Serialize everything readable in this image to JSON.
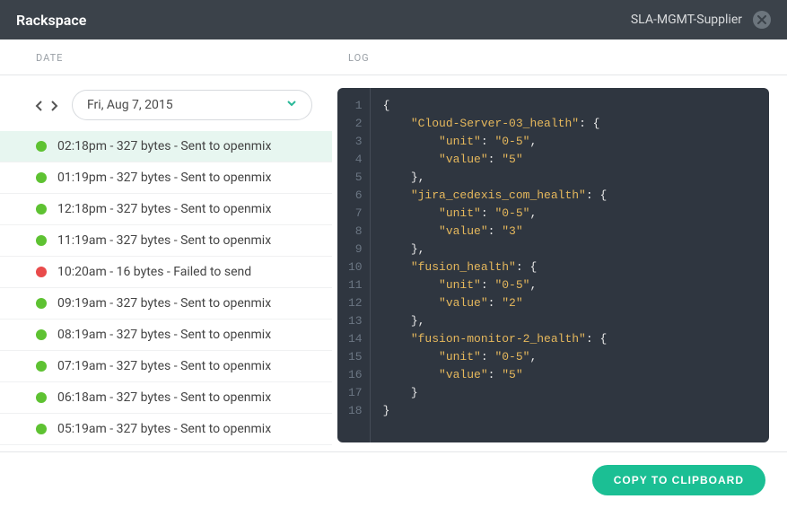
{
  "header": {
    "title": "Rackspace",
    "subtitle": "SLA-MGMT-Supplier"
  },
  "columns": {
    "date_label": "DATE",
    "log_label": "LOG"
  },
  "date_picker": {
    "value": "Fri, Aug 7, 2015"
  },
  "logs": [
    {
      "status": "ok",
      "time": "02:18pm",
      "bytes": "327 bytes",
      "msg": "Sent to openmix",
      "selected": true
    },
    {
      "status": "ok",
      "time": "01:19pm",
      "bytes": "327 bytes",
      "msg": "Sent to openmix",
      "selected": false
    },
    {
      "status": "ok",
      "time": "12:18pm",
      "bytes": "327 bytes",
      "msg": "Sent to openmix",
      "selected": false
    },
    {
      "status": "ok",
      "time": "11:19am",
      "bytes": "327 bytes",
      "msg": "Sent to openmix",
      "selected": false
    },
    {
      "status": "err",
      "time": "10:20am",
      "bytes": "16 bytes",
      "msg": "Failed to send",
      "selected": false
    },
    {
      "status": "ok",
      "time": "09:19am",
      "bytes": "327 bytes",
      "msg": "Sent to openmix",
      "selected": false
    },
    {
      "status": "ok",
      "time": "08:19am",
      "bytes": "327 bytes",
      "msg": "Sent to openmix",
      "selected": false
    },
    {
      "status": "ok",
      "time": "07:19am",
      "bytes": "327 bytes",
      "msg": "Sent to openmix",
      "selected": false
    },
    {
      "status": "ok",
      "time": "06:18am",
      "bytes": "327 bytes",
      "msg": "Sent to openmix",
      "selected": false
    },
    {
      "status": "ok",
      "time": "05:19am",
      "bytes": "327 bytes",
      "msg": "Sent to openmix",
      "selected": false
    }
  ],
  "code": [
    {
      "n": 1,
      "indent": 0,
      "tokens": [
        {
          "t": "{",
          "c": "brace"
        }
      ]
    },
    {
      "n": 2,
      "indent": 1,
      "tokens": [
        {
          "t": "\"Cloud-Server-03_health\"",
          "c": "key"
        },
        {
          "t": ": ",
          "c": "colon"
        },
        {
          "t": "{",
          "c": "brace"
        }
      ]
    },
    {
      "n": 3,
      "indent": 2,
      "tokens": [
        {
          "t": "\"unit\"",
          "c": "key"
        },
        {
          "t": ": ",
          "c": "colon"
        },
        {
          "t": "\"0-5\"",
          "c": "str"
        },
        {
          "t": ",",
          "c": "punct"
        }
      ]
    },
    {
      "n": 4,
      "indent": 2,
      "tokens": [
        {
          "t": "\"value\"",
          "c": "key"
        },
        {
          "t": ": ",
          "c": "colon"
        },
        {
          "t": "\"5\"",
          "c": "str"
        }
      ]
    },
    {
      "n": 5,
      "indent": 1,
      "tokens": [
        {
          "t": "},",
          "c": "brace"
        }
      ]
    },
    {
      "n": 6,
      "indent": 1,
      "tokens": [
        {
          "t": "\"jira_cedexis_com_health\"",
          "c": "key"
        },
        {
          "t": ": ",
          "c": "colon"
        },
        {
          "t": "{",
          "c": "brace"
        }
      ]
    },
    {
      "n": 7,
      "indent": 2,
      "tokens": [
        {
          "t": "\"unit\"",
          "c": "key"
        },
        {
          "t": ": ",
          "c": "colon"
        },
        {
          "t": "\"0-5\"",
          "c": "str"
        },
        {
          "t": ",",
          "c": "punct"
        }
      ]
    },
    {
      "n": 8,
      "indent": 2,
      "tokens": [
        {
          "t": "\"value\"",
          "c": "key"
        },
        {
          "t": ": ",
          "c": "colon"
        },
        {
          "t": "\"3\"",
          "c": "str"
        }
      ]
    },
    {
      "n": 9,
      "indent": 1,
      "tokens": [
        {
          "t": "},",
          "c": "brace"
        }
      ]
    },
    {
      "n": 10,
      "indent": 1,
      "tokens": [
        {
          "t": "\"fusion_health\"",
          "c": "key"
        },
        {
          "t": ": ",
          "c": "colon"
        },
        {
          "t": "{",
          "c": "brace"
        }
      ]
    },
    {
      "n": 11,
      "indent": 2,
      "tokens": [
        {
          "t": "\"unit\"",
          "c": "key"
        },
        {
          "t": ": ",
          "c": "colon"
        },
        {
          "t": "\"0-5\"",
          "c": "str"
        },
        {
          "t": ",",
          "c": "punct"
        }
      ]
    },
    {
      "n": 12,
      "indent": 2,
      "tokens": [
        {
          "t": "\"value\"",
          "c": "key"
        },
        {
          "t": ": ",
          "c": "colon"
        },
        {
          "t": "\"2\"",
          "c": "str"
        }
      ]
    },
    {
      "n": 13,
      "indent": 1,
      "tokens": [
        {
          "t": "},",
          "c": "brace"
        }
      ]
    },
    {
      "n": 14,
      "indent": 1,
      "tokens": [
        {
          "t": "\"fusion-monitor-2_health\"",
          "c": "key"
        },
        {
          "t": ": ",
          "c": "colon"
        },
        {
          "t": "{",
          "c": "brace"
        }
      ]
    },
    {
      "n": 15,
      "indent": 2,
      "tokens": [
        {
          "t": "\"unit\"",
          "c": "key"
        },
        {
          "t": ": ",
          "c": "colon"
        },
        {
          "t": "\"0-5\"",
          "c": "str"
        },
        {
          "t": ",",
          "c": "punct"
        }
      ]
    },
    {
      "n": 16,
      "indent": 2,
      "tokens": [
        {
          "t": "\"value\"",
          "c": "key"
        },
        {
          "t": ": ",
          "c": "colon"
        },
        {
          "t": "\"5\"",
          "c": "str"
        }
      ]
    },
    {
      "n": 17,
      "indent": 1,
      "tokens": [
        {
          "t": "}",
          "c": "brace"
        }
      ]
    },
    {
      "n": 18,
      "indent": 0,
      "tokens": [
        {
          "t": "}",
          "c": "brace"
        }
      ]
    }
  ],
  "footer": {
    "copy_label": "COPY TO CLIPBOARD"
  }
}
